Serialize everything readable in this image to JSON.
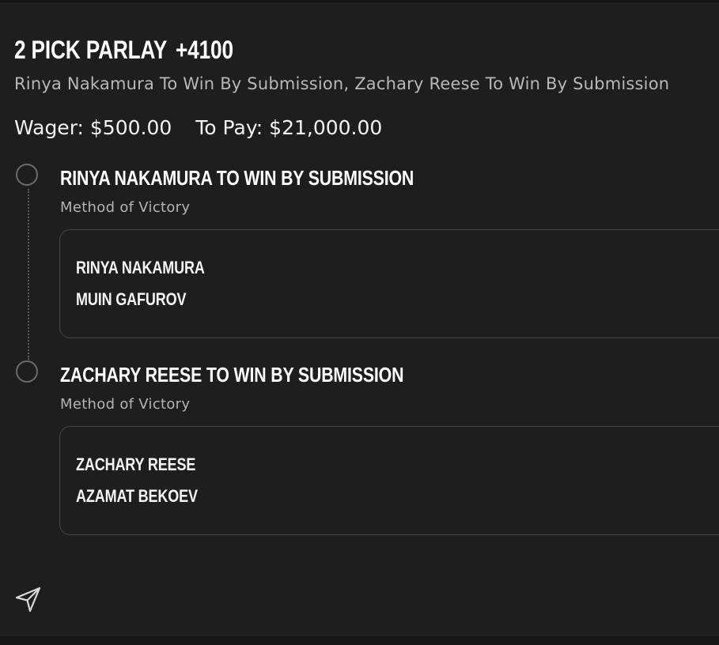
{
  "parlay": {
    "title": "2 PICK PARLAY",
    "odds": "+4100",
    "description": "Rinya Nakamura To Win By Submission, Zachary Reese To Win By Submission",
    "wager_label": "Wager: $500.00",
    "to_pay_label": "To Pay: $21,000.00"
  },
  "legs": [
    {
      "title": "RINYA NAKAMURA TO WIN BY SUBMISSION",
      "market": "Method of Victory",
      "fighters": [
        "RINYA NAKAMURA",
        "MUIN GAFUROV"
      ]
    },
    {
      "title": "ZACHARY REESE TO WIN BY SUBMISSION",
      "market": "Method of Victory",
      "fighters": [
        "ZACHARY REESE",
        "AZAMAT BEKOEV"
      ]
    }
  ],
  "icons": {
    "share": "send-icon"
  },
  "colors": {
    "background": "#1e1e1e",
    "text_primary": "#ffffff",
    "text_secondary": "#b8b8b8",
    "border": "#444444"
  }
}
